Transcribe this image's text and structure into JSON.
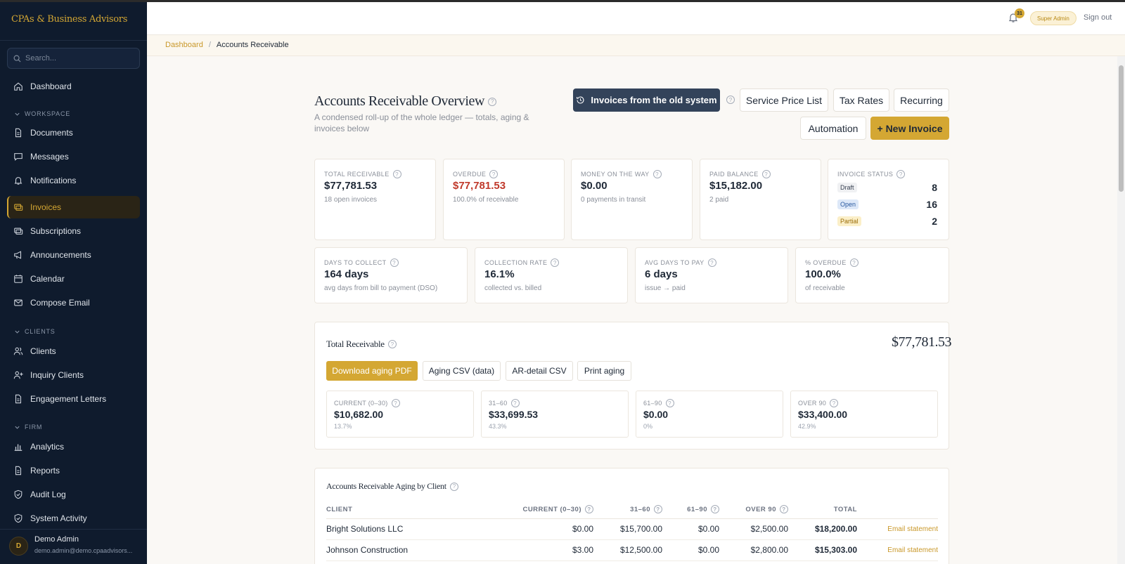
{
  "sidebar": {
    "brand": "CPAs & Business Advisors",
    "search_placeholder": "Search...",
    "items": {
      "dashboard": "Dashboard",
      "documents": "Documents",
      "messages": "Messages",
      "notifications": "Notifications",
      "invoices": "Invoices",
      "subscriptions": "Subscriptions",
      "announcements": "Announcements",
      "calendar": "Calendar",
      "compose_email": "Compose Email",
      "clients": "Clients",
      "inquiry_clients": "Inquiry Clients",
      "engagement_letters": "Engagement Letters",
      "analytics": "Analytics",
      "reports": "Reports",
      "audit_log": "Audit Log",
      "system_activity": "System Activity"
    },
    "sections": {
      "workspace": "WORKSPACE",
      "clients": "CLIENTS",
      "firm": "FIRM"
    },
    "user": {
      "initial": "D",
      "name": "Demo Admin",
      "email": "demo.admin@demo.cpaadvisors..."
    }
  },
  "header": {
    "notification_count": "31",
    "role": "Super Admin",
    "signout": "Sign out"
  },
  "breadcrumb": {
    "home": "Dashboard",
    "sep": "/",
    "current": "Accounts Receivable"
  },
  "page": {
    "title": "Accounts Receivable Overview",
    "subtitle": "A condensed roll-up of the whole ledger — totals, aging & invoices below",
    "buttons": {
      "old_system": "Invoices from the old system",
      "service_price_list": "Service Price List",
      "tax_rates": "Tax Rates",
      "recurring": "Recurring",
      "automation": "Automation",
      "new_invoice": "+ New Invoice"
    }
  },
  "kpis": {
    "total_receivable": {
      "label": "TOTAL RECEIVABLE",
      "value": "$77,781.53",
      "sub": "18 open invoices"
    },
    "overdue": {
      "label": "OVERDUE",
      "value": "$77,781.53",
      "sub": "100.0% of receivable"
    },
    "money_on_way": {
      "label": "MONEY ON THE WAY",
      "value": "$0.00",
      "sub": "0 payments in transit"
    },
    "paid_balance": {
      "label": "PAID BALANCE",
      "value": "$15,182.00",
      "sub": "2 paid"
    },
    "invoice_status": {
      "label": "INVOICE STATUS",
      "rows": [
        {
          "name": "Draft",
          "count": "8"
        },
        {
          "name": "Open",
          "count": "16"
        },
        {
          "name": "Partial",
          "count": "2"
        }
      ]
    },
    "days_to_collect": {
      "label": "DAYS TO COLLECT",
      "value": "164 days",
      "sub": "avg days from bill to payment (DSO)"
    },
    "collection_rate": {
      "label": "COLLECTION RATE",
      "value": "16.1%",
      "sub": "collected vs. billed"
    },
    "avg_days_to_pay": {
      "label": "AVG DAYS TO PAY",
      "value": "6 days",
      "sub": "issue → paid"
    },
    "pct_overdue": {
      "label": "% OVERDUE",
      "value": "100.0%",
      "sub": "of receivable"
    }
  },
  "total_panel": {
    "title": "Total Receivable",
    "total": "$77,781.53",
    "buttons": {
      "pdf": "Download aging PDF",
      "csv": "Aging CSV (data)",
      "ar_csv": "AR-detail CSV",
      "print": "Print aging"
    },
    "buckets": [
      {
        "label": "CURRENT (0–30)",
        "value": "$10,682.00",
        "pct": "13.7%"
      },
      {
        "label": "31–60",
        "value": "$33,699.53",
        "pct": "43.3%"
      },
      {
        "label": "61–90",
        "value": "$0.00",
        "pct": "0%"
      },
      {
        "label": "OVER 90",
        "value": "$33,400.00",
        "pct": "42.9%"
      }
    ]
  },
  "aging_table": {
    "title": "Accounts Receivable Aging by Client",
    "headers": {
      "client": "CLIENT",
      "current": "CURRENT (0–30)",
      "d31": "31–60",
      "d61": "61–90",
      "over90": "OVER 90",
      "total": "TOTAL"
    },
    "rows": [
      {
        "client": "Bright Solutions LLC",
        "current": "$0.00",
        "d31": "$15,700.00",
        "d61": "$0.00",
        "over90": "$2,500.00",
        "total": "$18,200.00",
        "action": "Email statement"
      },
      {
        "client": "Johnson Construction",
        "current": "$3.00",
        "d31": "$12,500.00",
        "d61": "$0.00",
        "over90": "$2,800.00",
        "total": "$15,303.00",
        "action": "Email statement"
      }
    ]
  },
  "colors": {
    "sidebar_bg": "#0f1b2d",
    "accent_gold": "#d4a733",
    "overdue_red": "#c0392b",
    "dark_button": "#33435a"
  }
}
